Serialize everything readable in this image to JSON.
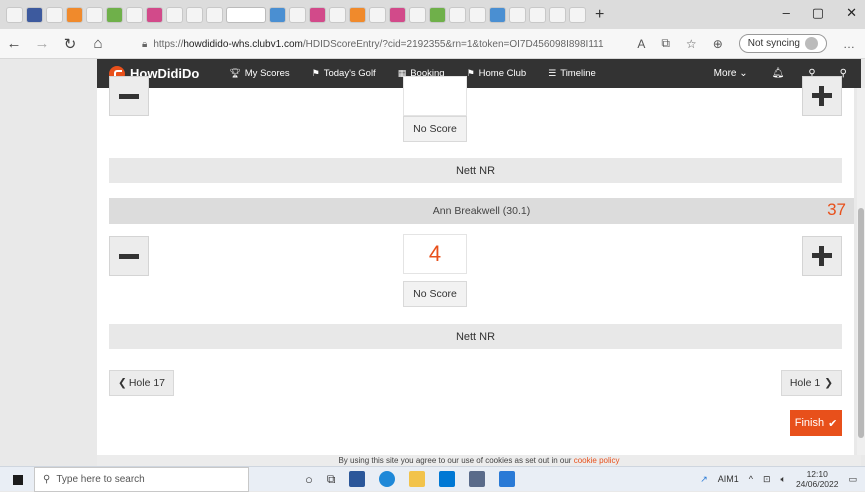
{
  "browser": {
    "url_prefix": "https://",
    "url_domain": "howdidido-whs.clubv1.com",
    "url_path": "/HDIDScoreEntry/?cid=2192355&rn=1&token=OI7D456098I898I111",
    "not_syncing_label": "Not syncing",
    "icons": [
      "back-icon",
      "forward-icon",
      "refresh-icon",
      "home-icon",
      "lock-icon",
      "favorites-icon",
      "collections-icon"
    ]
  },
  "sitenav": {
    "logo_text": "HowDidiDo",
    "items": [
      {
        "label": "My Scores",
        "icon": "trophy-icon"
      },
      {
        "label": "Today's Golf",
        "icon": "flag-icon"
      },
      {
        "label": "Booking",
        "icon": "calendar-icon"
      },
      {
        "label": "Home Club",
        "icon": "flag-icon"
      },
      {
        "label": "Timeline",
        "icon": "list-icon"
      }
    ],
    "more_label": "More"
  },
  "scorecard": {
    "top_player": {
      "no_score_label": "No Score",
      "nett_label": "Nett NR"
    },
    "player": {
      "name": "Ann Breakwell (30.1)",
      "total": "37",
      "score": "4",
      "no_score_label": "No Score",
      "nett_label": "Nett NR"
    },
    "prev_hole_label": "Hole 17",
    "next_hole_label": "Hole 1",
    "finish_label": "Finish"
  },
  "cookie_banner": {
    "text": "By using this site you agree to our use of cookies as set out in our",
    "link": "cookie policy"
  },
  "taskbar": {
    "search_placeholder": "Type here to search",
    "weather": "AIM1",
    "time": "12:10",
    "date": "24/06/2022"
  }
}
